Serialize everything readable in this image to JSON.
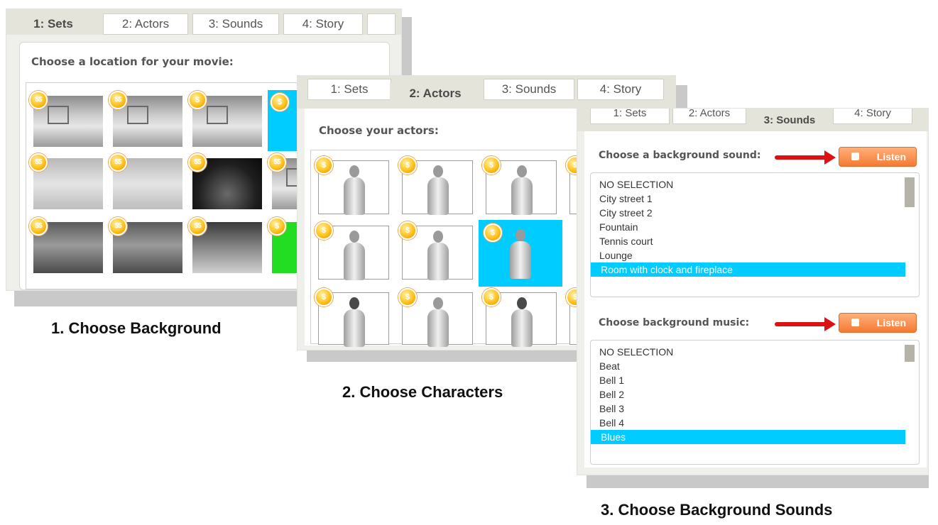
{
  "sets_panel": {
    "tabs": [
      "1: Sets",
      "2: Actors",
      "3: Sounds",
      "4: Story"
    ],
    "active_tab": "1: Sets",
    "prompt": "Choose a location for your movie:",
    "thumbnails": [
      {
        "coin": "$$",
        "scene": "room"
      },
      {
        "coin": "$$",
        "scene": "room"
      },
      {
        "coin": "$",
        "scene": "room"
      },
      {
        "coin": "$",
        "scene": "selected"
      },
      {
        "coin": "$$",
        "scene": "kitchen"
      },
      {
        "coin": "$$",
        "scene": "kitchen"
      },
      {
        "coin": "$$",
        "scene": "stage"
      },
      {
        "coin": "$$",
        "scene": "room"
      },
      {
        "coin": "$$",
        "scene": "garage"
      },
      {
        "coin": "$$",
        "scene": "sauna"
      },
      {
        "coin": "$$",
        "scene": "city"
      },
      {
        "coin": "$",
        "scene": "green-screen"
      }
    ],
    "caption": "1. Choose Background"
  },
  "actors_panel": {
    "tabs": [
      "1: Sets",
      "2: Actors",
      "3: Sounds",
      "4: Story"
    ],
    "active_tab": "2: Actors",
    "prompt": "Choose your actors:",
    "coin": "$",
    "caption": "2. Choose Characters"
  },
  "sounds_panel": {
    "tabs": [
      "1: Sets",
      "2: Actors",
      "3: Sounds",
      "4: Story"
    ],
    "active_tab": "3: Sounds",
    "background_sound": {
      "label": "Choose a background sound:",
      "listen_label": "Listen",
      "options": [
        "NO SELECTION",
        "City street 1",
        "City street 2",
        "Fountain",
        "Tennis court",
        "Lounge",
        "Room with clock and fireplace"
      ],
      "selected": "Room with clock and fireplace"
    },
    "background_music": {
      "label": "Choose background music:",
      "listen_label": "Listen",
      "options": [
        "NO SELECTION",
        "Beat",
        "Bell 1",
        "Bell 2",
        "Bell 3",
        "Bell 4",
        "Blues"
      ],
      "selected": "Blues"
    },
    "caption": "3. Choose Background Sounds"
  },
  "colors": {
    "selection_blue": "#00ccff",
    "listen_orange": "#f47a33",
    "arrow_red": "#dd1111",
    "coin_gold": "#ffc21a"
  }
}
